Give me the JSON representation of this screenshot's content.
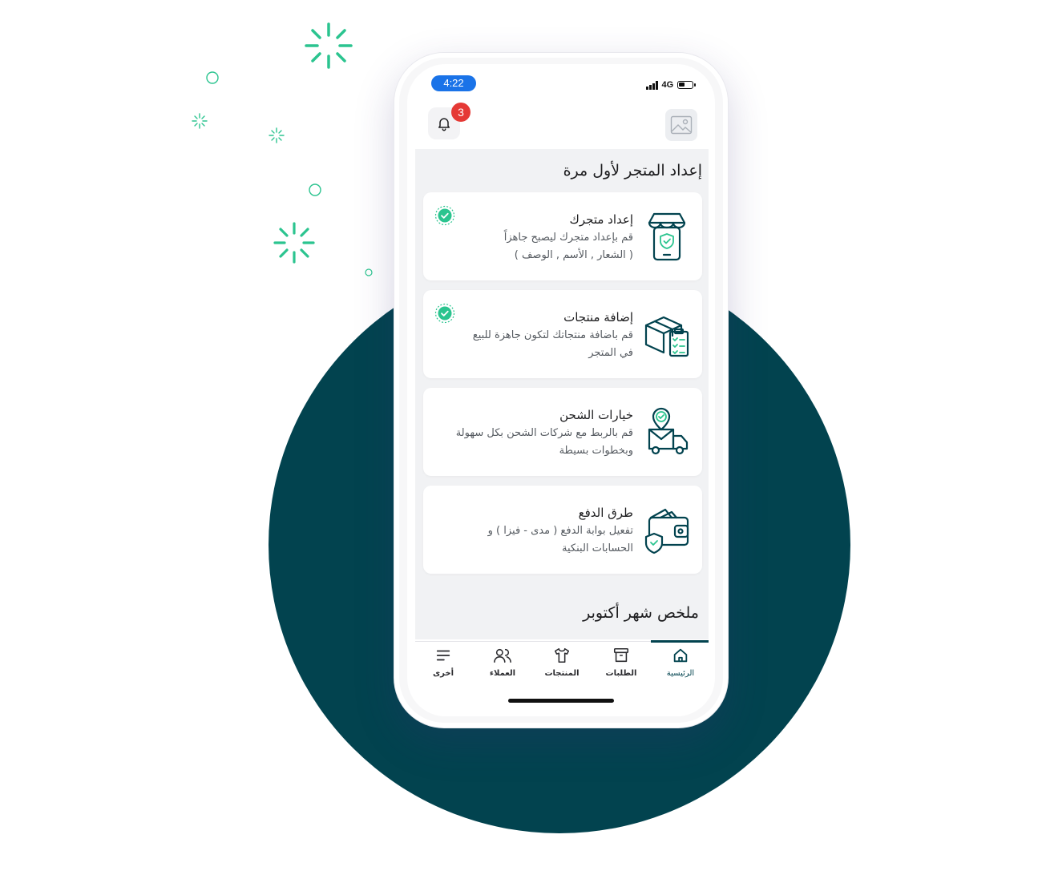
{
  "colors": {
    "accent": "#02434f",
    "confetti": "#2bc48f",
    "badge": "#e53935",
    "time_pill": "#1a73e8"
  },
  "status_bar": {
    "time": "4:22",
    "network": "4G",
    "battery_level": 0.5
  },
  "header": {
    "notification_icon": "bell-icon",
    "notification_count": "3",
    "logo_icon": "image-placeholder-icon"
  },
  "setup": {
    "title": "إعداد المتجر لأول مرة",
    "cards": [
      {
        "title": "إعداد متجرك",
        "desc_line1": "قم بإعداد متجرك ليصبح جاهزاً",
        "desc_line2": "( الشعار , الأسم , الوصف )",
        "icon": "store-phone-icon",
        "completed": true
      },
      {
        "title": "إضافة منتجات",
        "desc_line1": "قم باضافة منتجاتك لتكون جاهزة للبيع",
        "desc_line2": "في المتجر",
        "icon": "box-checklist-icon",
        "completed": true
      },
      {
        "title": "خيارات الشحن",
        "desc_line1": "قم بالربط مع شركات الشحن بكل سهولة",
        "desc_line2": "وبخطوات بسيطة",
        "icon": "delivery-truck-icon",
        "completed": false
      },
      {
        "title": "طرق الدفع",
        "desc_line1": "تفعيل بوابة الدفع ( مدى - فيزا ) و",
        "desc_line2": "الحسابات البنكية",
        "icon": "wallet-shield-icon",
        "completed": false
      }
    ]
  },
  "summary": {
    "title": "ملخص شهر أكتوبر"
  },
  "tabs": [
    {
      "label": "الرئيسية",
      "icon": "home-icon",
      "active": true
    },
    {
      "label": "الطلبات",
      "icon": "archive-box-icon",
      "active": false
    },
    {
      "label": "المنتجات",
      "icon": "shirt-icon",
      "active": false
    },
    {
      "label": "العملاء",
      "icon": "users-icon",
      "active": false
    },
    {
      "label": "أخرى",
      "icon": "menu-icon",
      "active": false
    }
  ]
}
